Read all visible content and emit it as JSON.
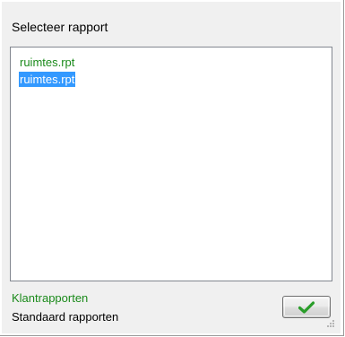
{
  "dialog": {
    "title": "Selecteer rapport"
  },
  "report_list": {
    "items": [
      {
        "label": "ruimtes.rpt",
        "kind": "client",
        "selected": false
      },
      {
        "label": "ruimtes.rpt",
        "kind": "client",
        "selected": true
      }
    ]
  },
  "legend": {
    "client_reports": "Klantrapporten",
    "standard_reports": "Standaard rapporten"
  },
  "buttons": {
    "ok_icon": "checkmark-icon"
  },
  "colors": {
    "client_report_text": "#1a8a1a",
    "selection_background": "#3399ff",
    "checkmark": "#2a9d2a"
  }
}
